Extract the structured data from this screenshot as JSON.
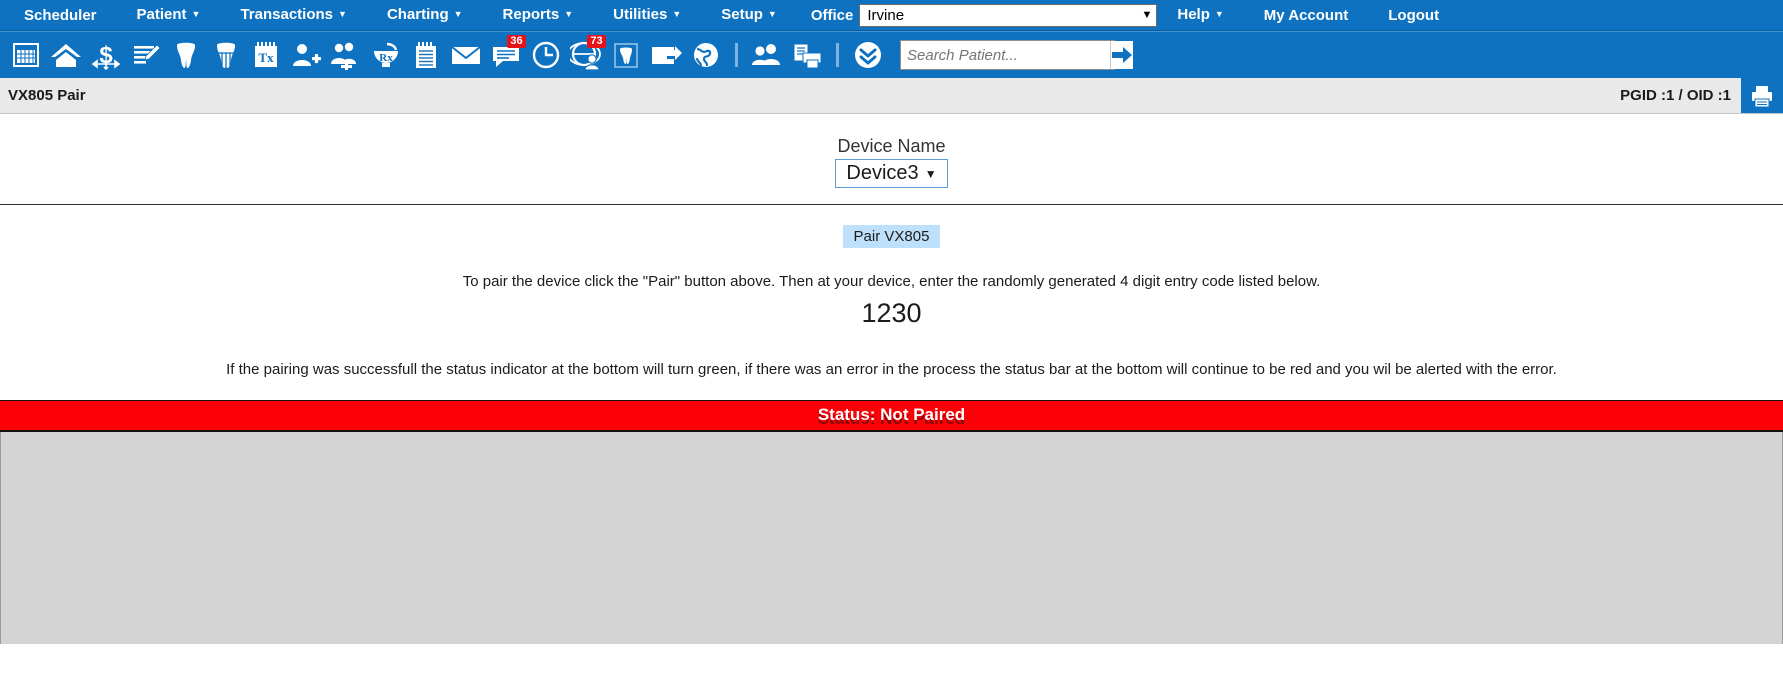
{
  "menubar": {
    "items": [
      {
        "label": "Scheduler",
        "caret": false
      },
      {
        "label": "Patient",
        "caret": true
      },
      {
        "label": "Transactions",
        "caret": true
      },
      {
        "label": "Charting",
        "caret": true
      },
      {
        "label": "Reports",
        "caret": true
      },
      {
        "label": "Utilities",
        "caret": true
      },
      {
        "label": "Setup",
        "caret": true
      }
    ],
    "office_label": "Office",
    "office_value": "Irvine",
    "right_items": [
      {
        "label": "Help",
        "caret": true
      },
      {
        "label": "My Account",
        "caret": false
      },
      {
        "label": "Logout",
        "caret": false
      }
    ],
    "caret_glyph": "▼"
  },
  "toolbar": {
    "icons": [
      {
        "name": "calendar-grid-icon",
        "badge": ""
      },
      {
        "name": "home-icon",
        "badge": ""
      },
      {
        "name": "dollar-move-icon",
        "badge": ""
      },
      {
        "name": "edit-notes-icon",
        "badge": ""
      },
      {
        "name": "tooth-icon",
        "badge": ""
      },
      {
        "name": "tooth-perio-icon",
        "badge": ""
      },
      {
        "name": "treatment-plan-icon",
        "badge": ""
      },
      {
        "name": "add-patient-icon",
        "badge": ""
      },
      {
        "name": "add-family-icon",
        "badge": ""
      },
      {
        "name": "prescription-rx-icon",
        "badge": ""
      },
      {
        "name": "clipboard-notes-icon",
        "badge": ""
      },
      {
        "name": "envelope-mail-icon",
        "badge": ""
      },
      {
        "name": "chat-messages-icon",
        "badge": "36"
      },
      {
        "name": "clock-icon",
        "badge": ""
      },
      {
        "name": "global-patient-icon",
        "badge": "73"
      }
    ],
    "icons2": [
      {
        "name": "tooth-chart-icon",
        "badge": ""
      },
      {
        "name": "screen-transfer-icon",
        "badge": ""
      },
      {
        "name": "globe-web-icon",
        "badge": ""
      }
    ],
    "icons3": [
      {
        "name": "users-group-icon",
        "badge": ""
      },
      {
        "name": "print-documents-icon",
        "badge": ""
      }
    ],
    "icons4": [
      {
        "name": "double-chevron-down-icon",
        "badge": ""
      }
    ],
    "search_placeholder": "Search Patient...",
    "search_value": "",
    "search_go_icon": "arrow-right-icon"
  },
  "titlebar": {
    "page_title": "VX805 Pair",
    "pgid_text": "PGID :1  /  OID :1",
    "print_icon": "printer-icon"
  },
  "main": {
    "device_label": "Device Name",
    "device_value": "Device3",
    "device_caret": "▼",
    "pair_button": "Pair VX805",
    "instruction": "To pair the device click the \"Pair\" button above. Then at your device, enter the randomly generated 4 digit entry code listed below.",
    "entry_code": "1230",
    "note": "If the pairing was successfull the status indicator at the bottom will turn green, if there was an error in the process the status bar at the bottom will continue to be red and you wil be alerted with the error.",
    "status_text": "Status: Not Paired",
    "status_color": "#fb0006"
  }
}
